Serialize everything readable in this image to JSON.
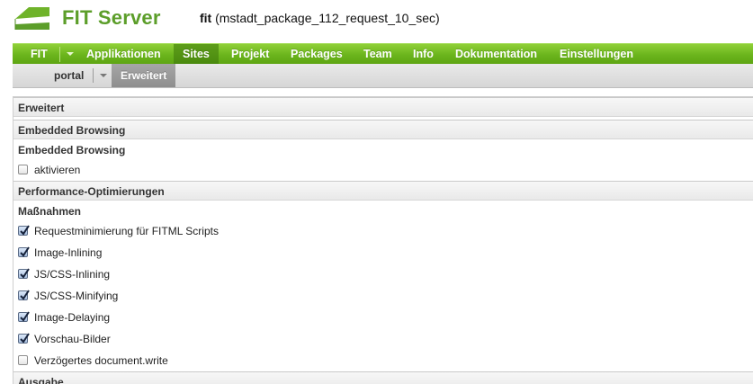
{
  "header": {
    "brand": "FIT Server",
    "context_bold": "fit",
    "context_rest": " (mstadt_package_112_request_10_sec)"
  },
  "mainnav": {
    "fit": "FIT",
    "items": [
      "Applikationen",
      "Sites",
      "Projekt",
      "Packages",
      "Team",
      "Info",
      "Dokumentation",
      "Einstellungen"
    ]
  },
  "subnav": {
    "portal": "portal",
    "active": "Erweitert"
  },
  "content": {
    "sections": {
      "erweitert": "Erweitert",
      "embedded": "Embedded Browsing",
      "performance": "Performance-Optimierungen",
      "ausgabe": "Ausgabe"
    },
    "embedded": {
      "heading": "Embedded Browsing",
      "options": [
        {
          "label": "aktivieren",
          "checked": false
        }
      ]
    },
    "performance": {
      "heading": "Maßnahmen",
      "options": [
        {
          "label": "Requestminimierung für FITML Scripts",
          "checked": true
        },
        {
          "label": "Image-Inlining",
          "checked": true
        },
        {
          "label": "JS/CSS-Inlining",
          "checked": true
        },
        {
          "label": "JS/CSS-Minifying",
          "checked": true
        },
        {
          "label": "Image-Delaying",
          "checked": true
        },
        {
          "label": "Vorschau-Bilder",
          "checked": true
        },
        {
          "label": "Verzögertes document.write",
          "checked": false
        }
      ]
    }
  }
}
